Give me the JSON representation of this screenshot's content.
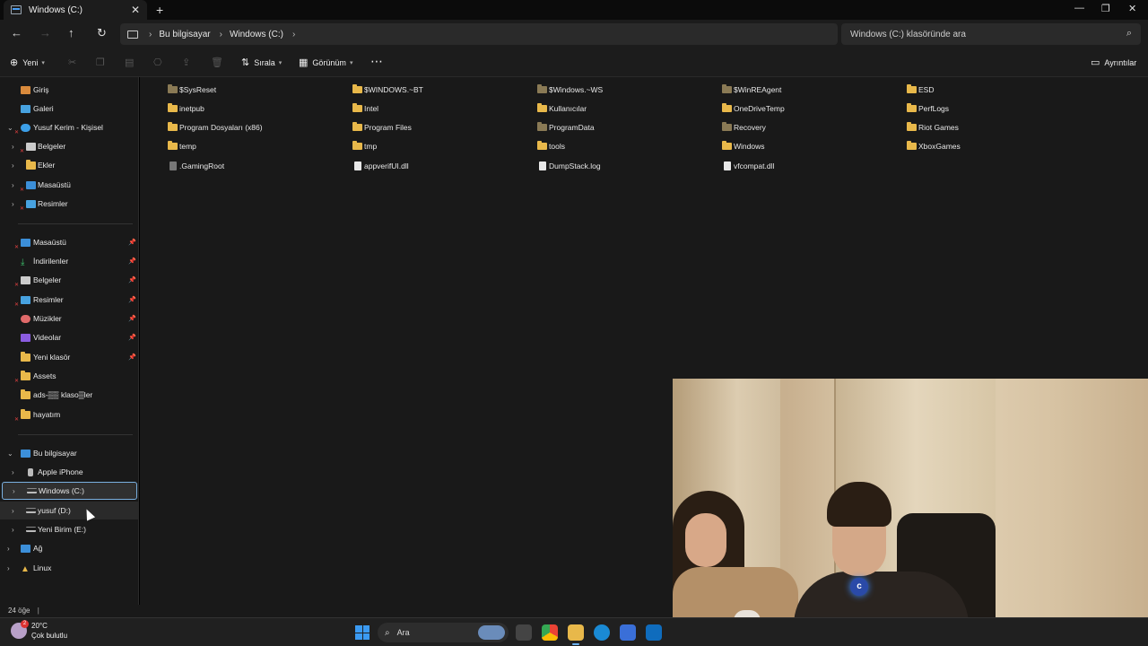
{
  "window": {
    "tab_title": "Windows (C:)",
    "new_tab": "+",
    "tab_close": "✕",
    "min": "—",
    "max": "❐",
    "close": "✕"
  },
  "address": {
    "crumbs": [
      "Bu bilgisayar",
      "Windows (C:)"
    ],
    "search_placeholder": "Windows (C:) klasöründe ara"
  },
  "toolbar": {
    "new_label": "Yeni",
    "sort_label": "Sırala",
    "view_label": "Görünüm",
    "more_label": "⋯",
    "details_label": "Ayrıntılar"
  },
  "sidebar": {
    "home": "Giriş",
    "gallery": "Galeri",
    "onedrive": "Yusuf Kerim - Kişisel",
    "od_items": [
      "Belgeler",
      "Ekler",
      "Masaüstü",
      "Resimler"
    ],
    "quick": [
      "Masaüstü",
      "İndirilenler",
      "Belgeler",
      "Resimler",
      "Müzikler",
      "Videolar",
      "Yeni klasör",
      "Assets",
      "ads-▒▒ klaso▒ler",
      "hayatım"
    ],
    "thispc": "Bu bilgisayar",
    "pc_items": [
      "Apple iPhone",
      "Windows (C:)",
      "yusuf (D:)",
      "Yeni Birim (E:)"
    ],
    "network": "Ağ",
    "linux": "Linux"
  },
  "files": {
    "col1": [
      "$SysReset",
      "inetpub",
      "Program Dosyaları (x86)",
      "temp",
      ".GamingRoot"
    ],
    "col2": [
      "$WINDOWS.~BT",
      "Intel",
      "Program Files",
      "tmp",
      "appverifUI.dll"
    ],
    "col3": [
      "$Windows.~WS",
      "Kullanıcılar",
      "ProgramData",
      "tools",
      "DumpStack.log"
    ],
    "col4": [
      "$WinREAgent",
      "OneDriveTemp",
      "Recovery",
      "Windows",
      "vfcompat.dll"
    ],
    "col5": [
      "ESD",
      "PerfLogs",
      "Riot Games",
      "XboxGames"
    ]
  },
  "status": {
    "count": "24 öğe",
    "bar": "|"
  },
  "taskbar": {
    "temp": "20°C",
    "weather": "Çok bulutlu",
    "search": "Ara"
  },
  "colors": {
    "folder": "#e8b84a",
    "accent": "#3b9af2",
    "selection_border": "#7ab0e0"
  }
}
